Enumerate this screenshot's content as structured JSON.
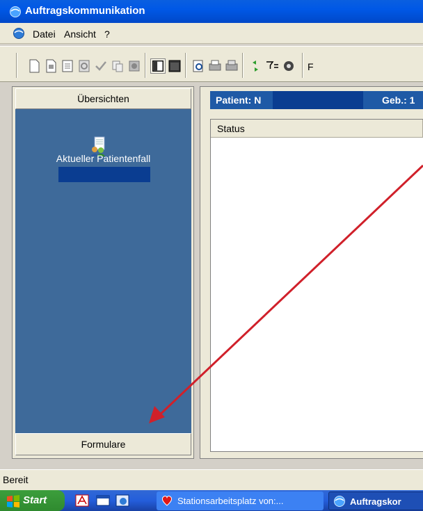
{
  "window": {
    "title": "Auftragskommunikation"
  },
  "menu": {
    "items": [
      "Datei",
      "Ansicht",
      "?"
    ]
  },
  "toolbar": {
    "buttons": [
      "new-document-icon",
      "new-form-icon",
      "list-icon",
      "refresh-doc-icon",
      "check-icon",
      "copy-icon",
      "attach-icon",
      "layout-split-icon",
      "layout-full-icon",
      "preview-icon",
      "print-icon",
      "print-setup-icon",
      "sync-icon",
      "filter-icon",
      "settings-icon"
    ],
    "overflow_label": "F"
  },
  "left_panel": {
    "header": "Übersichten",
    "case_label": "Aktueller Patientenfall",
    "footer_button": "Formulare"
  },
  "right_panel": {
    "patient_label": "Patient: N",
    "geb_label": "Geb.: 1",
    "column_status": "Status"
  },
  "statusbar": {
    "text": "Bereit"
  },
  "taskbar": {
    "start_label": "Start",
    "tasks": [
      "Stationsarbeitsplatz von:...",
      "Auftragskor"
    ]
  },
  "colors": {
    "nav_background": "#3e6a9a",
    "patient_bar": "#1f5aa6",
    "annotation_arrow": "#d0202a"
  }
}
